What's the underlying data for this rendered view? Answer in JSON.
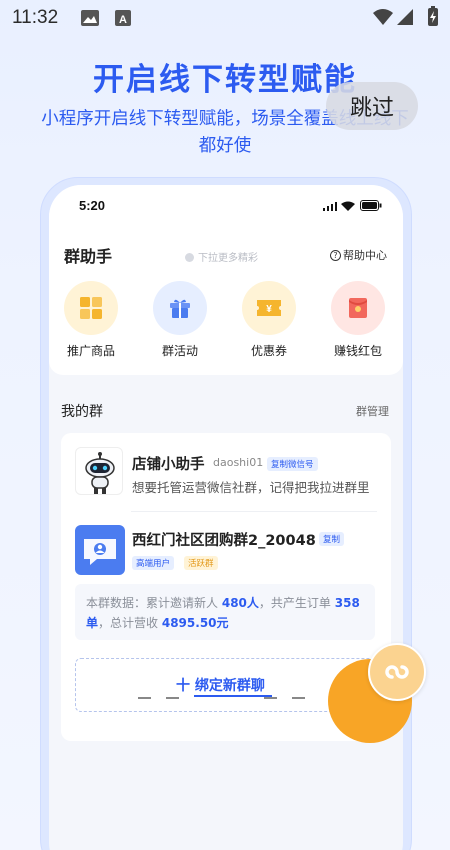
{
  "status_bar": {
    "time": "11:32"
  },
  "hero": {
    "title": "开启线下转型赋能",
    "subtitle": "小程序开启线下转型赋能，场景全覆盖线上线下都好使"
  },
  "skip_button": {
    "label": "跳过"
  },
  "phone": {
    "status_time": "5:20",
    "app_name": "群助手",
    "pull_hint": "下拉更多精彩",
    "help_label": "帮助中心",
    "quick_actions": [
      {
        "label": "推广商品",
        "icon": "grid-product-icon",
        "bg": "#fff3d6"
      },
      {
        "label": "群活动",
        "icon": "gift-icon",
        "bg": "#e6eeff"
      },
      {
        "label": "优惠券",
        "icon": "coupon-icon",
        "bg": "#fff3d6"
      },
      {
        "label": "赚钱红包",
        "icon": "red-envelope-icon",
        "bg": "#ffe6e3"
      }
    ],
    "my_groups_title": "我的群",
    "group_manage": "群管理",
    "groups": [
      {
        "name": "店铺小助手",
        "id": "daoshi01",
        "copy_badge": "复制微信号",
        "description": "想要托管运营微信社群，记得把我拉进群里"
      },
      {
        "name": "西红门社区团购群2_20048",
        "copy_badge": "复制",
        "tags": [
          "高端用户",
          "活跃群"
        ]
      }
    ],
    "stats": {
      "prefix": "本群数据：累计邀请新人",
      "invites": "480人",
      "mid": "，共产生订单",
      "orders": "358单",
      "mid2": "，总计营收",
      "revenue": "4895.50元"
    },
    "bind_button": "十 绑定新群聊"
  },
  "colors": {
    "accent": "#2c5bf0",
    "orange": "#f8a526"
  }
}
